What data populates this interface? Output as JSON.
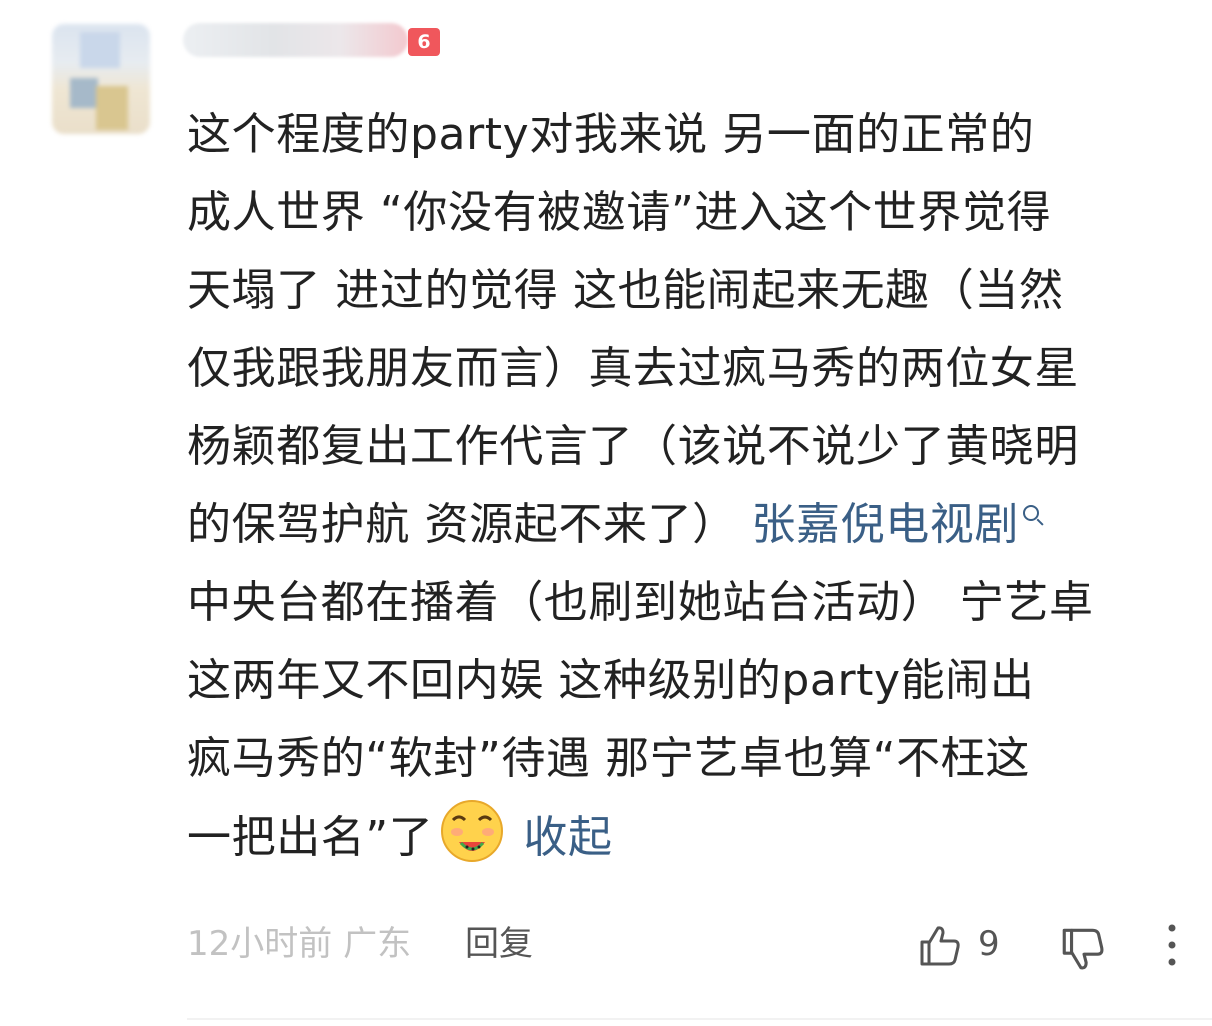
{
  "user": {
    "level_badge": "6"
  },
  "comment": {
    "lines": [
      "这个程度的party对我来说 另一面的正常的",
      "成人世界 “你没有被邀请”进入这个世界觉得",
      "天塌了 进过的觉得 这也能闹起来无趣（当然",
      "仅我跟我朋友而言）真去过疯马秀的两位女星",
      "杨颖都复出工作代言了（该说不说少了黄晓明",
      "的保驾护航 资源起不来了）",
      "中央台都在播着（也刷到她站台活动） 宁艺卓",
      "这两年又不回内娱 这种级别的party能闹出",
      "疯马秀的“软封”待遇 那宁艺卓也算“不枉这",
      "一把出名”了"
    ],
    "link_text": "张嘉倪电视剧",
    "collapse_label": "收起",
    "emoji": "grinning-watermelon-emoji"
  },
  "meta": {
    "time": "12小时前",
    "location": "广东",
    "reply_label": "回复",
    "like_count": "9"
  },
  "icons": {
    "like": "thumbs-up-icon",
    "dislike": "thumbs-down-icon",
    "more": "more-vertical-icon",
    "search": "search-icon"
  },
  "colors": {
    "link": "#3a5f86",
    "text": "#222222",
    "meta": "#c2c2c2",
    "badge": "#f0575c"
  }
}
